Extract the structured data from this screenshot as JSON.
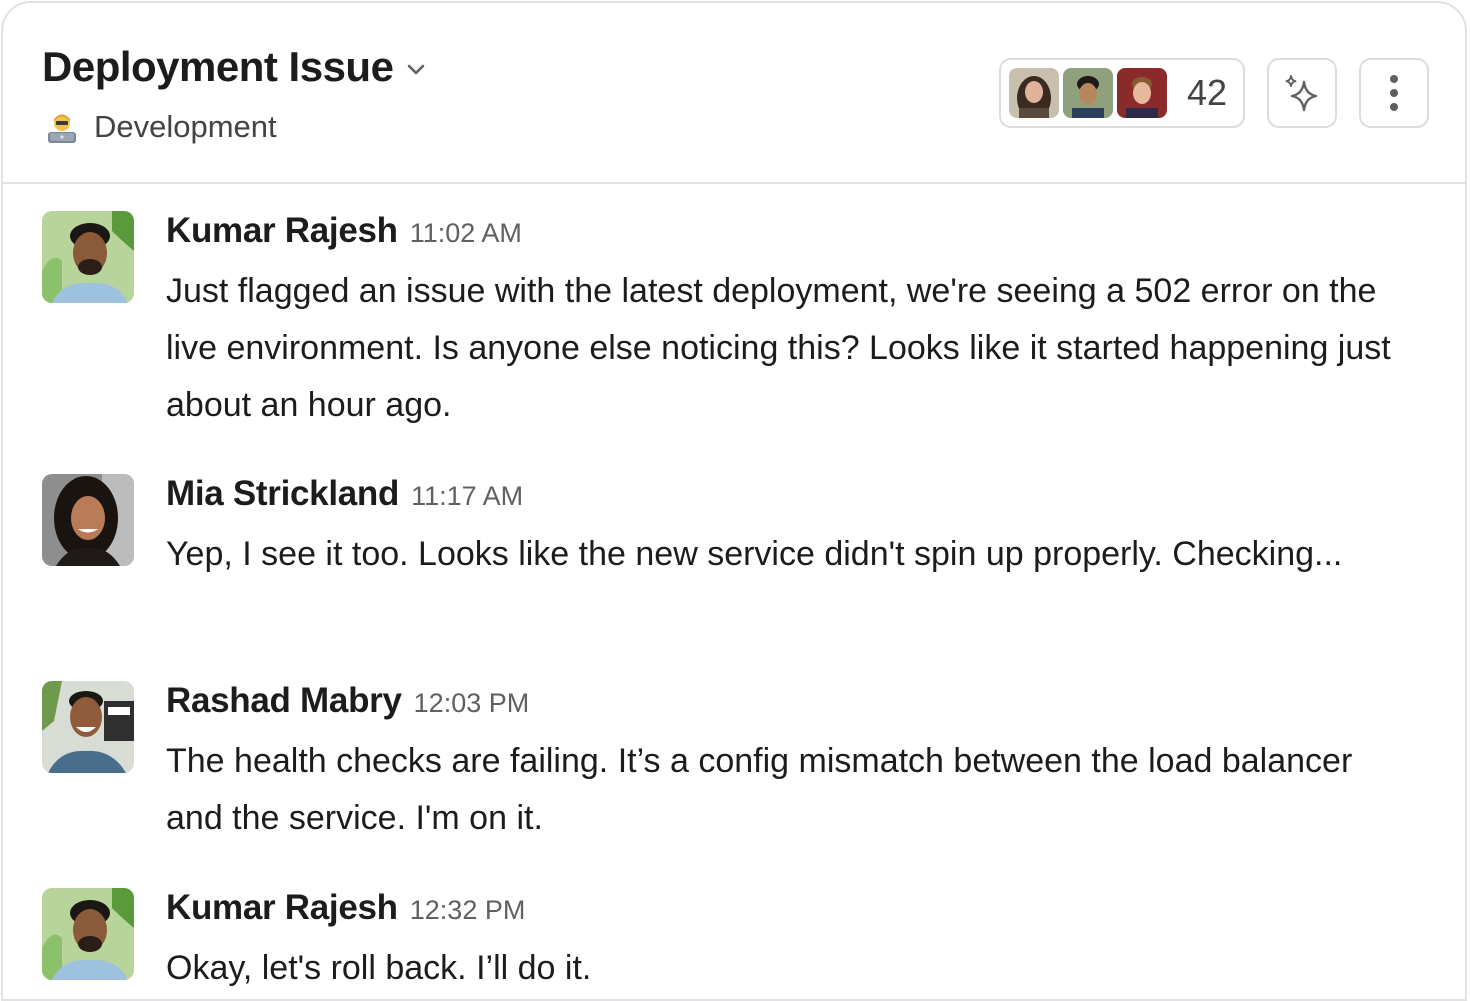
{
  "header": {
    "title": "Deployment Issue",
    "subtitle": "Development",
    "subtitle_icon": "technologist-emoji-icon",
    "member_count": "42",
    "ai_icon": "sparkle-icon",
    "more_icon": "kebab-menu-icon"
  },
  "messages": [
    {
      "author": "Kumar Rajesh",
      "time": "11:02 AM",
      "text": "Just flagged an issue with the latest deployment, we're seeing a 502 error on the live environment. Is anyone else noticing this? Looks like it started happening just about an hour ago."
    },
    {
      "author": "Mia Strickland",
      "time": "11:17 AM",
      "text": "Yep, I see it too. Looks like the new service didn't spin up properly. Checking..."
    },
    {
      "author": "Rashad Mabry",
      "time": "12:03 PM",
      "text": "The health checks are failing. It’s a config mismatch between the load balancer and the service. I'm on it."
    },
    {
      "author": "Kumar Rajesh",
      "time": "12:32 PM",
      "text": "Okay, let's roll back. I’ll do it."
    }
  ],
  "colors": {
    "text": "#1d1c1d",
    "muted": "#616061",
    "border": "#e3e1e3"
  }
}
